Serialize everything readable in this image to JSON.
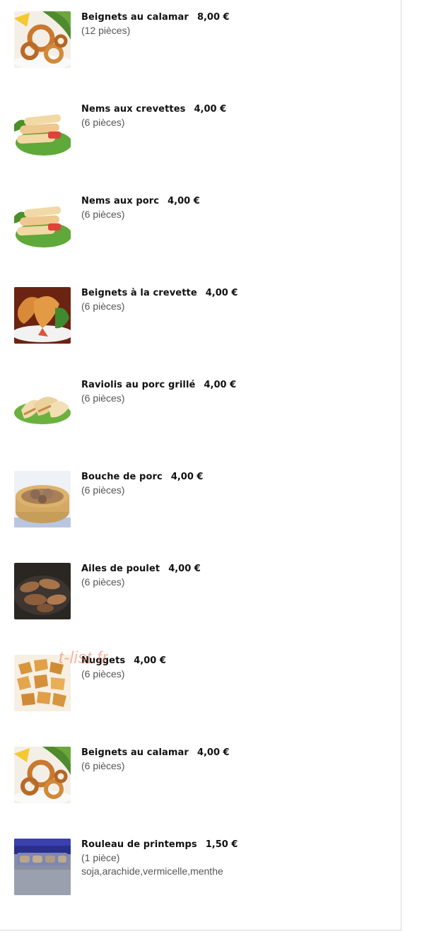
{
  "menu": {
    "items": [
      {
        "name": "Beignets au calamar",
        "price": "8,00 €",
        "qty": "(12 pièces)",
        "desc": "",
        "icon": "fried-calamari-icon"
      },
      {
        "name": "Nems aux crevettes",
        "price": "4,00 €",
        "qty": "(6 pièces)",
        "desc": "",
        "icon": "spring-rolls-icon"
      },
      {
        "name": "Nems aux porc",
        "price": "4,00 €",
        "qty": "(6 pièces)",
        "desc": "",
        "icon": "spring-rolls-icon"
      },
      {
        "name": "Beignets à la crevette",
        "price": "4,00 €",
        "qty": "(6 pièces)",
        "desc": "",
        "icon": "fried-shrimp-icon"
      },
      {
        "name": "Raviolis au porc grillé",
        "price": "4,00 €",
        "qty": "(6 pièces)",
        "desc": "",
        "icon": "dumplings-icon"
      },
      {
        "name": "Bouche de porc",
        "price": "4,00 €",
        "qty": "(6 pièces)",
        "desc": "",
        "icon": "steamer-basket-icon"
      },
      {
        "name": "Ailes de poulet",
        "price": "4,00 €",
        "qty": "(6 pièces)",
        "desc": "",
        "icon": "chicken-wings-icon"
      },
      {
        "name": "Nuggets",
        "price": "4,00 €",
        "qty": "(6 pièces)",
        "desc": "",
        "icon": "nuggets-icon"
      },
      {
        "name": "Beignets au calamar",
        "price": "4,00 €",
        "qty": "(6 pièces)",
        "desc": "",
        "icon": "fried-calamari-icon"
      },
      {
        "name": "Rouleau de printemps",
        "price": "1,50 €",
        "qty": "(1 pièce)",
        "desc": "soja,arachide,vermicelle,menthe",
        "icon": "spring-roll-pack-icon"
      }
    ]
  },
  "watermark": "t-list.fr"
}
